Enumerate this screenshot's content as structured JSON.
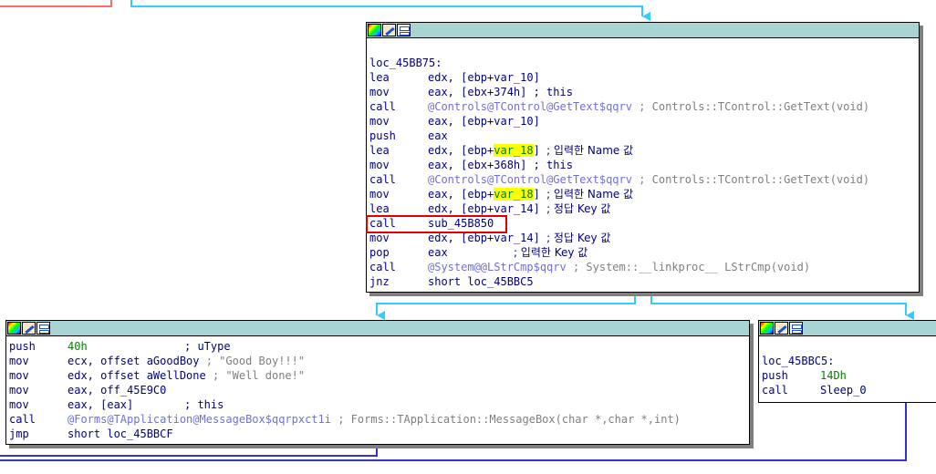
{
  "colors": {
    "edge_cyan": "#33ccff",
    "edge_blue": "#3333cc",
    "edge_red": "#ff6b6b",
    "header_bg": "#a9d4d4",
    "highlight": "#ffff00",
    "callout_red": "#e00000"
  },
  "header_icons": [
    "color-palette-icon",
    "edit-icon",
    "graph-view-icon"
  ],
  "main_block": {
    "label": "loc_45BB75:",
    "lines": [
      {
        "mn": "lea",
        "ops": "edx, [ebp+var_10]"
      },
      {
        "mn": "mov",
        "ops": "eax, [ebx+374h]",
        "comment": "; this"
      },
      {
        "mn": "call",
        "ops": "@Controls@TControl@GetText$qqrv",
        "comment": "; Controls::TControl::GetText(void)"
      },
      {
        "mn": "mov",
        "ops": "eax, [ebp+var_10]"
      },
      {
        "mn": "push",
        "ops": "eax"
      },
      {
        "mn": "lea",
        "ops_pre": "edx, [ebp+",
        "ops_hl": "var_18",
        "ops_post": "]",
        "comment": "; 입력한 Name 값"
      },
      {
        "mn": "mov",
        "ops": "eax, [ebx+368h]",
        "comment": "; this"
      },
      {
        "mn": "call",
        "ops": "@Controls@TControl@GetText$qqrv",
        "comment": "; Controls::TControl::GetText(void)"
      },
      {
        "mn": "mov",
        "ops_pre": "eax, [ebp+",
        "ops_hl": "var_18",
        "ops_post": "]",
        "comment": "; 입력한 Name 값"
      },
      {
        "mn": "lea",
        "ops": "edx, [ebp+var_14]",
        "comment": "; 정답 Key 값"
      },
      {
        "mn": "call",
        "ops": "sub_45B850"
      },
      {
        "mn": "mov",
        "ops": "edx, [ebp+var_14]",
        "comment": "; 정답 Key 값"
      },
      {
        "mn": "pop",
        "ops": "eax",
        "comment": "; 입력한 Key 값"
      },
      {
        "mn": "call",
        "ops": "@System@@LStrCmp$qqrv",
        "comment": "; System::__linkproc__ LStrCmp(void)"
      },
      {
        "mn": "jnz",
        "ops": "short loc_45BBC5"
      }
    ]
  },
  "left_block": {
    "lines": [
      {
        "mn": "push",
        "ops": "40h",
        "comment": "; uType"
      },
      {
        "mn": "mov",
        "ops": "ecx, offset aGoodBoy",
        "comment": "; \"Good Boy!!!\""
      },
      {
        "mn": "mov",
        "ops": "edx, offset aWellDone",
        "comment": "; \"Well done!\""
      },
      {
        "mn": "mov",
        "ops": "eax, off_45E9C0"
      },
      {
        "mn": "mov",
        "ops": "eax, [eax]",
        "comment": "; this"
      },
      {
        "mn": "call",
        "ops": "@Forms@TApplication@MessageBox$qqrpxct1i",
        "comment": "; Forms::TApplication::MessageBox(char *,char *,int)"
      },
      {
        "mn": "jmp",
        "ops": "short loc_45BBCF"
      }
    ]
  },
  "right_block": {
    "label": "loc_45BBC5:",
    "lines": [
      {
        "mn": "push",
        "ops": "14Dh"
      },
      {
        "mn": "call",
        "ops": "Sleep_0"
      }
    ]
  }
}
